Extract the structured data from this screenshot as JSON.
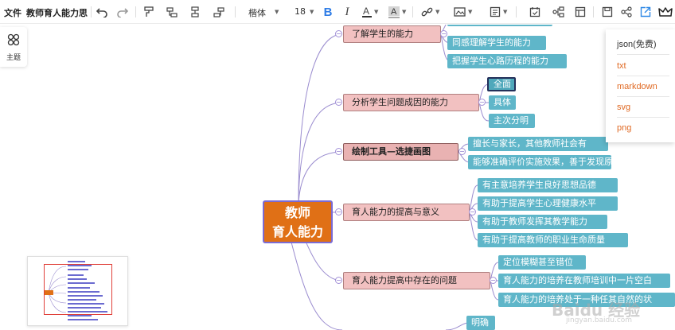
{
  "toolbar": {
    "file_menu": "文件",
    "doc_title": "教师育人能力思",
    "font_family": "楷体",
    "font_size": "18",
    "icons": [
      "undo-icon",
      "redo-icon",
      "format-painter-icon",
      "insert-child-icon",
      "insert-sibling-icon",
      "insert-parent-icon",
      "bold-icon",
      "italic-icon",
      "font-color-icon",
      "highlight-icon",
      "link-icon",
      "image-icon",
      "note-icon",
      "calendar-icon",
      "summary-icon",
      "layout-icon",
      "save-icon",
      "share-icon",
      "export-icon",
      "crown-icon"
    ]
  },
  "left_panel": {
    "theme_label": "主题"
  },
  "mindmap": {
    "root": {
      "line1": "教师",
      "line2": "育人能力"
    },
    "branches": [
      {
        "label": "了解学生的能力",
        "leaves": [
          "同感理解学生的能力",
          "把握学生心路历程的能力"
        ]
      },
      {
        "label": "分析学生问题成因的能力",
        "leaves": [
          "全面",
          "具体",
          "主次分明"
        ]
      },
      {
        "label": "绘制工具—选捷画图",
        "leaves": [
          "擅长与家长，其他教师社会有",
          "能够准确评价实施效果，善于发现原定教育方"
        ]
      },
      {
        "label": "育人能力的提高与意义",
        "leaves": [
          "有主意培养学生良好思想品德",
          "有助于提高学生心理健康水平",
          "有助于教师发挥其教学能力",
          "有助于提高教师的职业生命质量"
        ]
      },
      {
        "label": "育人能力提高中存在的问题",
        "leaves": [
          "定位模糊甚至错位",
          "育人能力的培养在教师培训中一片空白",
          "育人能力的培养处于一种任其自然的状"
        ]
      },
      {
        "label": "",
        "leaves": [
          "明确"
        ]
      }
    ]
  },
  "export_menu": {
    "items": [
      "json(免费)",
      "txt",
      "markdown",
      "svg",
      "png"
    ]
  },
  "watermark": {
    "main": "Baidu 经验",
    "sub": "jingyan.baidu.com"
  },
  "colors": {
    "root_bg": "#e07016",
    "root_border": "#7b6bd3",
    "branch_bg": "#f2c1c1",
    "leaf_bg": "#5fb6c9",
    "connector": "#9a8ccf",
    "accent": "#e06a24",
    "export_active": "#2e88e6"
  }
}
